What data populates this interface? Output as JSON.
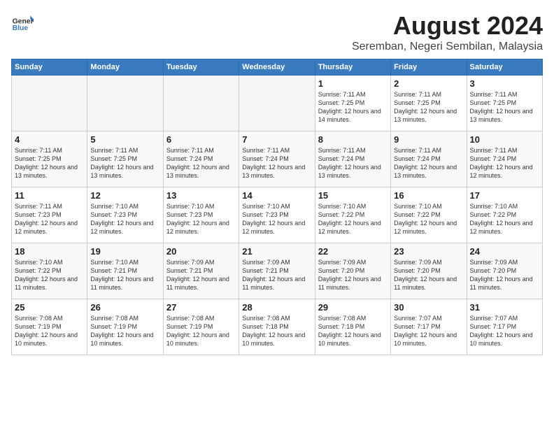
{
  "logo": {
    "general": "General",
    "blue": "Blue"
  },
  "title": "August 2024",
  "subtitle": "Seremban, Negeri Sembilan, Malaysia",
  "days_of_week": [
    "Sunday",
    "Monday",
    "Tuesday",
    "Wednesday",
    "Thursday",
    "Friday",
    "Saturday"
  ],
  "weeks": [
    [
      {
        "day": "",
        "empty": true
      },
      {
        "day": "",
        "empty": true
      },
      {
        "day": "",
        "empty": true
      },
      {
        "day": "",
        "empty": true
      },
      {
        "day": "1",
        "sunrise": "7:11 AM",
        "sunset": "7:25 PM",
        "daylight": "12 hours and 14 minutes."
      },
      {
        "day": "2",
        "sunrise": "7:11 AM",
        "sunset": "7:25 PM",
        "daylight": "12 hours and 13 minutes."
      },
      {
        "day": "3",
        "sunrise": "7:11 AM",
        "sunset": "7:25 PM",
        "daylight": "12 hours and 13 minutes."
      }
    ],
    [
      {
        "day": "4",
        "sunrise": "7:11 AM",
        "sunset": "7:25 PM",
        "daylight": "12 hours and 13 minutes."
      },
      {
        "day": "5",
        "sunrise": "7:11 AM",
        "sunset": "7:25 PM",
        "daylight": "12 hours and 13 minutes."
      },
      {
        "day": "6",
        "sunrise": "7:11 AM",
        "sunset": "7:24 PM",
        "daylight": "12 hours and 13 minutes."
      },
      {
        "day": "7",
        "sunrise": "7:11 AM",
        "sunset": "7:24 PM",
        "daylight": "12 hours and 13 minutes."
      },
      {
        "day": "8",
        "sunrise": "7:11 AM",
        "sunset": "7:24 PM",
        "daylight": "12 hours and 13 minutes."
      },
      {
        "day": "9",
        "sunrise": "7:11 AM",
        "sunset": "7:24 PM",
        "daylight": "12 hours and 13 minutes."
      },
      {
        "day": "10",
        "sunrise": "7:11 AM",
        "sunset": "7:24 PM",
        "daylight": "12 hours and 12 minutes."
      }
    ],
    [
      {
        "day": "11",
        "sunrise": "7:11 AM",
        "sunset": "7:23 PM",
        "daylight": "12 hours and 12 minutes."
      },
      {
        "day": "12",
        "sunrise": "7:10 AM",
        "sunset": "7:23 PM",
        "daylight": "12 hours and 12 minutes."
      },
      {
        "day": "13",
        "sunrise": "7:10 AM",
        "sunset": "7:23 PM",
        "daylight": "12 hours and 12 minutes."
      },
      {
        "day": "14",
        "sunrise": "7:10 AM",
        "sunset": "7:23 PM",
        "daylight": "12 hours and 12 minutes."
      },
      {
        "day": "15",
        "sunrise": "7:10 AM",
        "sunset": "7:22 PM",
        "daylight": "12 hours and 12 minutes."
      },
      {
        "day": "16",
        "sunrise": "7:10 AM",
        "sunset": "7:22 PM",
        "daylight": "12 hours and 12 minutes."
      },
      {
        "day": "17",
        "sunrise": "7:10 AM",
        "sunset": "7:22 PM",
        "daylight": "12 hours and 12 minutes."
      }
    ],
    [
      {
        "day": "18",
        "sunrise": "7:10 AM",
        "sunset": "7:22 PM",
        "daylight": "12 hours and 11 minutes."
      },
      {
        "day": "19",
        "sunrise": "7:10 AM",
        "sunset": "7:21 PM",
        "daylight": "12 hours and 11 minutes."
      },
      {
        "day": "20",
        "sunrise": "7:09 AM",
        "sunset": "7:21 PM",
        "daylight": "12 hours and 11 minutes."
      },
      {
        "day": "21",
        "sunrise": "7:09 AM",
        "sunset": "7:21 PM",
        "daylight": "12 hours and 11 minutes."
      },
      {
        "day": "22",
        "sunrise": "7:09 AM",
        "sunset": "7:20 PM",
        "daylight": "12 hours and 11 minutes."
      },
      {
        "day": "23",
        "sunrise": "7:09 AM",
        "sunset": "7:20 PM",
        "daylight": "12 hours and 11 minutes."
      },
      {
        "day": "24",
        "sunrise": "7:09 AM",
        "sunset": "7:20 PM",
        "daylight": "12 hours and 11 minutes."
      }
    ],
    [
      {
        "day": "25",
        "sunrise": "7:08 AM",
        "sunset": "7:19 PM",
        "daylight": "12 hours and 10 minutes."
      },
      {
        "day": "26",
        "sunrise": "7:08 AM",
        "sunset": "7:19 PM",
        "daylight": "12 hours and 10 minutes."
      },
      {
        "day": "27",
        "sunrise": "7:08 AM",
        "sunset": "7:19 PM",
        "daylight": "12 hours and 10 minutes."
      },
      {
        "day": "28",
        "sunrise": "7:08 AM",
        "sunset": "7:18 PM",
        "daylight": "12 hours and 10 minutes."
      },
      {
        "day": "29",
        "sunrise": "7:08 AM",
        "sunset": "7:18 PM",
        "daylight": "12 hours and 10 minutes."
      },
      {
        "day": "30",
        "sunrise": "7:07 AM",
        "sunset": "7:17 PM",
        "daylight": "12 hours and 10 minutes."
      },
      {
        "day": "31",
        "sunrise": "7:07 AM",
        "sunset": "7:17 PM",
        "daylight": "12 hours and 10 minutes."
      }
    ]
  ]
}
